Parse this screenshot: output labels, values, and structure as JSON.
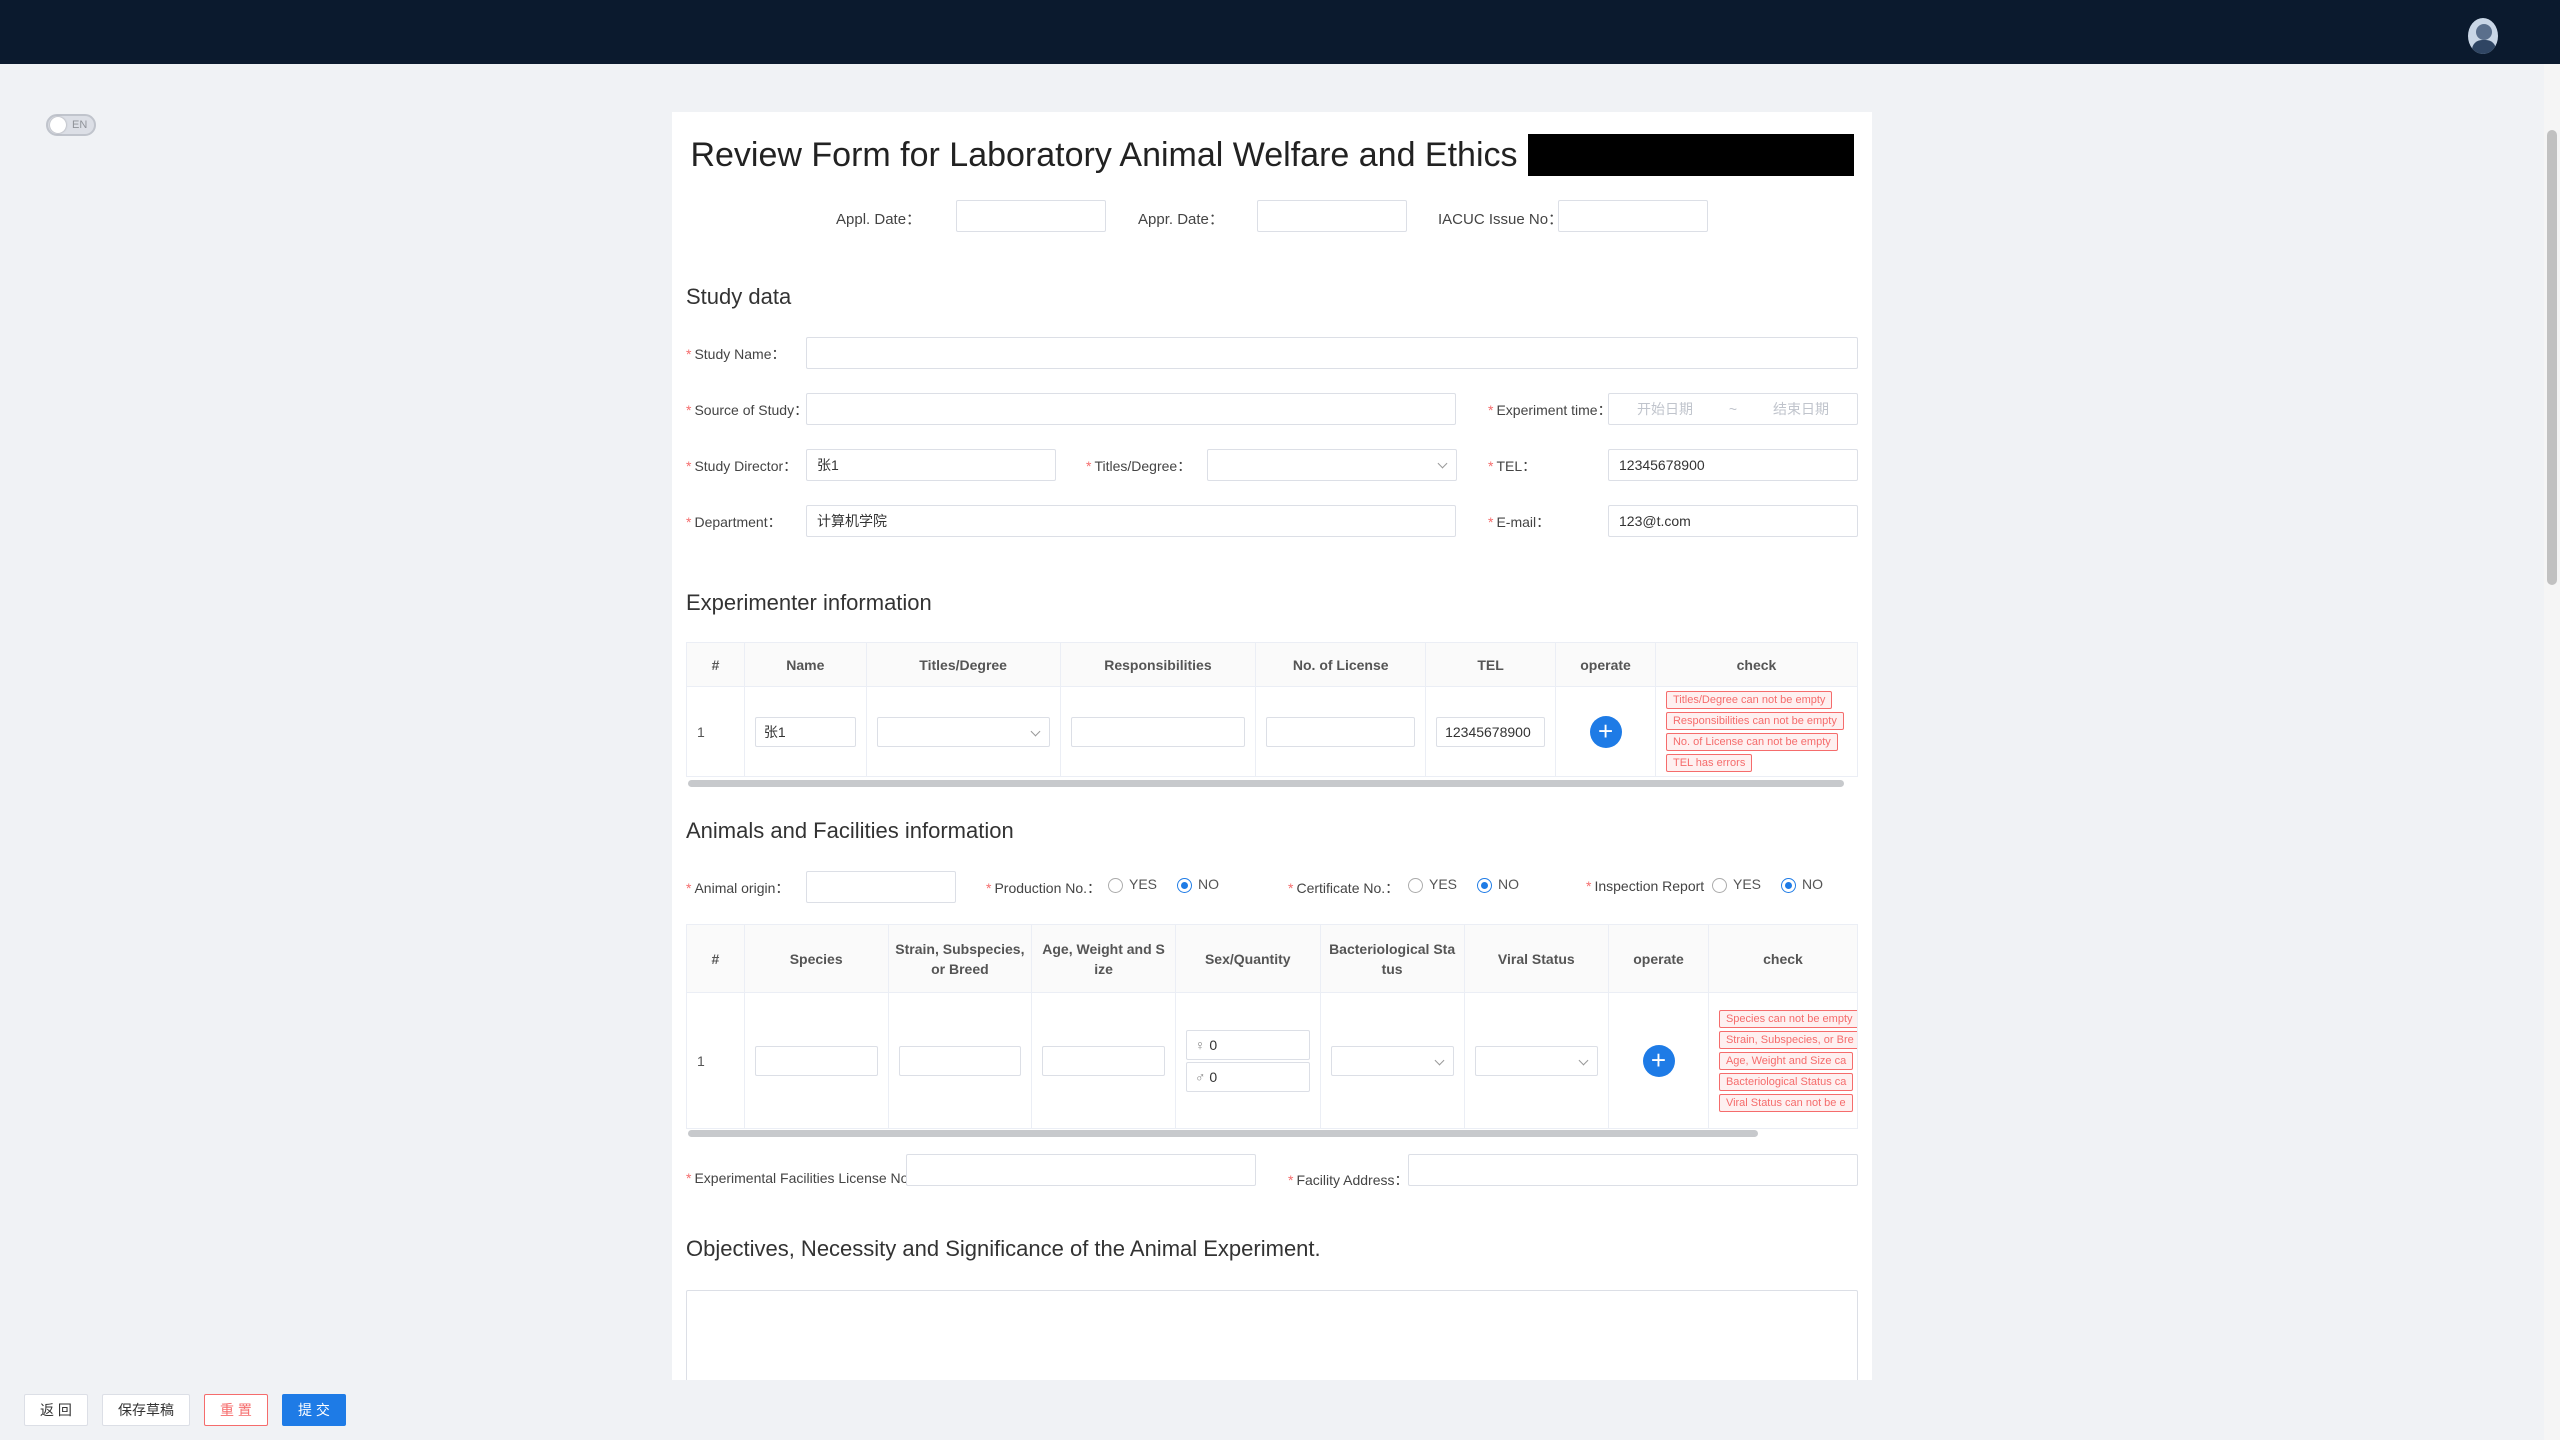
{
  "topbar": {
    "avatar": "user-avatar-icon"
  },
  "lang_toggle": {
    "label": "EN"
  },
  "form": {
    "title": "Review Form for Laboratory Animal Welfare and Ethics",
    "appl_date_label": "Appl. Date：",
    "appr_date_label": "Appr. Date：",
    "iacuc_label": "IACUC Issue No：",
    "appl_date": "",
    "appr_date": "",
    "iacuc_no": ""
  },
  "study": {
    "section_title": "Study data",
    "name_label": "Study Name：",
    "name_value": "",
    "source_label": "Source of Study：",
    "source_value": "",
    "exp_time_label": "Experiment time：",
    "start_placeholder": "开始日期",
    "range_sep": "~",
    "end_placeholder": "结束日期",
    "director_label": "Study Director：",
    "director_value": "张1",
    "titles_label": "Titles/Degree：",
    "titles_value": "",
    "tel_label": "TEL：",
    "tel_value": "12345678900",
    "dept_label": "Department：",
    "dept_value": "计算机学院",
    "email_label": "E-mail：",
    "email_value": "123@t.com"
  },
  "experimenter": {
    "section_title": "Experimenter information",
    "columns": [
      "#",
      "Name",
      "Titles/Degree",
      "Responsibilities",
      "No. of License",
      "TEL",
      "operate",
      "check"
    ],
    "rows": [
      {
        "index": "1",
        "name": "张1",
        "titles": "",
        "resp": "",
        "license": "",
        "tel": "12345678900",
        "errors": [
          "Titles/Degree can not be empty",
          "Responsibilities can not be empty",
          "No. of License can not be empty",
          "TEL has errors"
        ]
      }
    ]
  },
  "animals": {
    "section_title": "Animals and Facilities information",
    "origin_label": "Animal origin：",
    "origin_value": "",
    "production_label": "Production No.：",
    "certificate_label": "Certificate No.：",
    "inspection_label": "Inspection Report",
    "yes": "YES",
    "no": "NO",
    "production_selected": "NO",
    "certificate_selected": "NO",
    "inspection_selected": "NO",
    "columns": [
      "#",
      "Species",
      "Strain, Subspecies, or Breed",
      "Age, Weight and S ize",
      "Sex/Quantity",
      "Bacteriological Sta tus",
      "Viral Status",
      "operate",
      "check"
    ],
    "rows": [
      {
        "index": "1",
        "female_qty": "0",
        "male_qty": "0",
        "errors": [
          "Species can not be empty",
          "Strain, Subspecies, or Bre",
          "Age, Weight and Size ca",
          "Bacteriological Status ca",
          "Viral Status can not be e"
        ]
      }
    ],
    "facility_license_label": "Experimental Facilities License No.",
    "facility_license_value": "",
    "facility_address_label": "Facility Address：",
    "facility_address_value": ""
  },
  "objectives": {
    "section_title": "Objectives, Necessity and Significance of the Animal Experiment.",
    "value": ""
  },
  "footer": {
    "back": "返 回",
    "save_draft": "保存草稿",
    "reset": "重 置",
    "submit": "提 交"
  }
}
